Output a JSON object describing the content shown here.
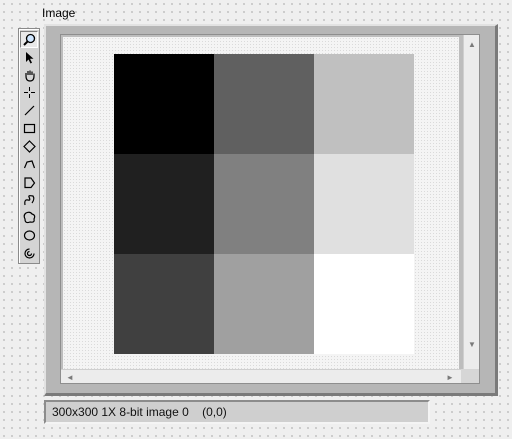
{
  "control": {
    "label": "Image"
  },
  "toolbar": {
    "tools": [
      {
        "icon": "zoom-icon",
        "selected": true
      },
      {
        "icon": "pointer-icon",
        "selected": false
      },
      {
        "icon": "pan-hand-icon",
        "selected": false
      },
      {
        "icon": "point-icon",
        "selected": false
      },
      {
        "icon": "line-icon",
        "selected": false
      },
      {
        "icon": "rectangle-icon",
        "selected": false
      },
      {
        "icon": "rotated-rectangle-icon",
        "selected": false
      },
      {
        "icon": "polyline-icon",
        "selected": false
      },
      {
        "icon": "polygon-icon",
        "selected": false
      },
      {
        "icon": "freehand-line-icon",
        "selected": false
      },
      {
        "icon": "freehand-region-icon",
        "selected": false
      },
      {
        "icon": "oval-icon",
        "selected": false
      },
      {
        "icon": "annulus-icon",
        "selected": false
      }
    ]
  },
  "image": {
    "grid": [
      [
        "#000000",
        "#606060",
        "#c0c0c0"
      ],
      [
        "#202020",
        "#808080",
        "#e0e0e0"
      ],
      [
        "#404040",
        "#a0a0a0",
        "#ffffff"
      ]
    ]
  },
  "status": {
    "text": "300x300 1X 8-bit image 0    (0,0)"
  },
  "scroll": {
    "up": "▲",
    "down": "▼",
    "left": "◄",
    "right": "►"
  }
}
